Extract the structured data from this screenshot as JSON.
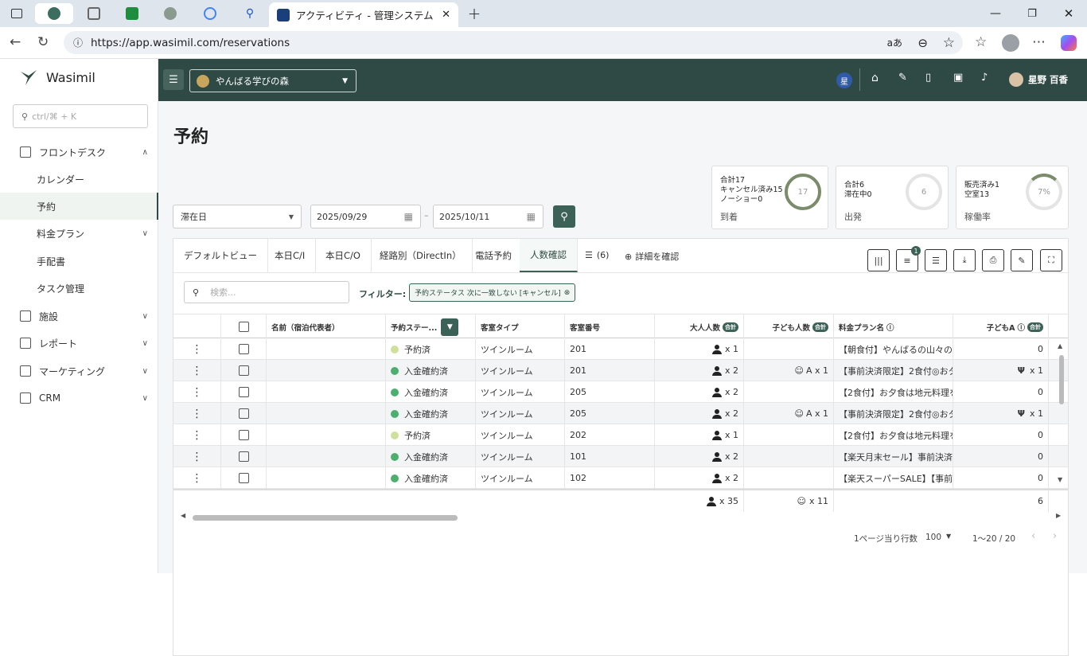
{
  "browser": {
    "tab_title": "アクティビティ - 管理システム",
    "url": "https://app.wasimil.com/reservations",
    "tab_close": "✕",
    "new_tab": "+",
    "reader_mode": "aあ"
  },
  "sidebar": {
    "brand": "Wasimil",
    "search_placeholder": "ctrl/⌘ + K",
    "items": [
      {
        "label": "フロントデスク",
        "icon": "monitor-icon",
        "expanded": true
      },
      {
        "label": "カレンダー"
      },
      {
        "label": "予約",
        "active": true
      },
      {
        "label": "料金プラン",
        "chevron": true
      },
      {
        "label": "手配書"
      },
      {
        "label": "タスク管理"
      },
      {
        "label": "施設",
        "icon": "building-icon",
        "chevron": true
      },
      {
        "label": "レポート",
        "icon": "chart-icon",
        "chevron": true
      },
      {
        "label": "マーケティング",
        "icon": "mail-icon",
        "chevron": true
      },
      {
        "label": "CRM",
        "icon": "crm-icon",
        "chevron": true
      }
    ]
  },
  "header": {
    "property": "やんばる学びの森",
    "user_badge": "星",
    "user_name": "星野 百香"
  },
  "page": {
    "title": "予約"
  },
  "stats": [
    {
      "lines": [
        "合計17",
        "キャンセル済み15",
        "ノーショー0"
      ],
      "label": "到着",
      "ring": "17",
      "ring_pct": 1.0
    },
    {
      "lines": [
        "合計6",
        "滞在中0"
      ],
      "label": "出発",
      "ring": "6",
      "ring_pct": 0
    },
    {
      "lines": [
        "販売済み1",
        "空室13"
      ],
      "label": "稼働率",
      "ring": "7%",
      "ring_pct": 0.07
    }
  ],
  "filters": {
    "date_type": "滞在日",
    "date_from": "2025/09/29",
    "date_sep": "–",
    "date_to": "2025/10/11"
  },
  "views": [
    {
      "label": "デフォルトビュー"
    },
    {
      "label": "本日C/I"
    },
    {
      "label": "本日C/O"
    },
    {
      "label": "経路別（DirectIn）"
    },
    {
      "label": "電話予約"
    },
    {
      "label": "人数確認",
      "active": true
    }
  ],
  "views_more": "(6)",
  "details_link": "詳細を確認",
  "filter_badge": "1",
  "search": {
    "placeholder": "検索..."
  },
  "filter_label": "フィルター:",
  "filter_chip": "予約ステータス 次に一致しない [キャンセル]",
  "columns": {
    "name": "名前（宿泊代表者）",
    "status": "予約ステー...",
    "room_type": "客室タイプ",
    "room_no": "客室番号",
    "adults": "大人人数",
    "children": "子ども人数",
    "plan": "料金プラン名",
    "child_a": "子どもA",
    "total_badge": "合計"
  },
  "rows": [
    {
      "status": "予約済",
      "status_color": "#cfe09a",
      "room_type": "ツインルーム",
      "room_no": "201",
      "adults": "x 1",
      "children": "",
      "plan": "【朝食付】やんばるの山々の",
      "child_a": "0"
    },
    {
      "status": "入金確約済",
      "status_color": "#4caf6e",
      "room_type": "ツインルーム",
      "room_no": "201",
      "adults": "x 2",
      "children": "A x 1",
      "plan": "【事前決済限定】2食付◎おタ",
      "child_a": "x 1"
    },
    {
      "status": "入金確約済",
      "status_color": "#4caf6e",
      "room_type": "ツインルーム",
      "room_no": "205",
      "adults": "x 2",
      "children": "",
      "plan": "【2食付】お夕食は地元料理を",
      "child_a": "0"
    },
    {
      "status": "入金確約済",
      "status_color": "#4caf6e",
      "room_type": "ツインルーム",
      "room_no": "205",
      "adults": "x 2",
      "children": "A x 1",
      "plan": "【事前決済限定】2食付◎おタ",
      "child_a": "x 1"
    },
    {
      "status": "予約済",
      "status_color": "#cfe09a",
      "room_type": "ツインルーム",
      "room_no": "202",
      "adults": "x 1",
      "children": "",
      "plan": "【2食付】お夕食は地元料理を",
      "child_a": "0"
    },
    {
      "status": "入金確約済",
      "status_color": "#4caf6e",
      "room_type": "ツインルーム",
      "room_no": "101",
      "adults": "x 2",
      "children": "",
      "plan": "【楽天月末セール】事前決済",
      "child_a": "0"
    },
    {
      "status": "入金確約済",
      "status_color": "#4caf6e",
      "room_type": "ツインルーム",
      "room_no": "102",
      "adults": "x 2",
      "children": "",
      "plan": "【楽天スーパーSALE】【事前決",
      "child_a": "0"
    }
  ],
  "totals": {
    "adults": "x 35",
    "children": "x 11",
    "child_a": "6"
  },
  "pagination": {
    "rows_label": "1ページ当り行数",
    "rows_value": "100",
    "range": "1〜20 / 20"
  }
}
